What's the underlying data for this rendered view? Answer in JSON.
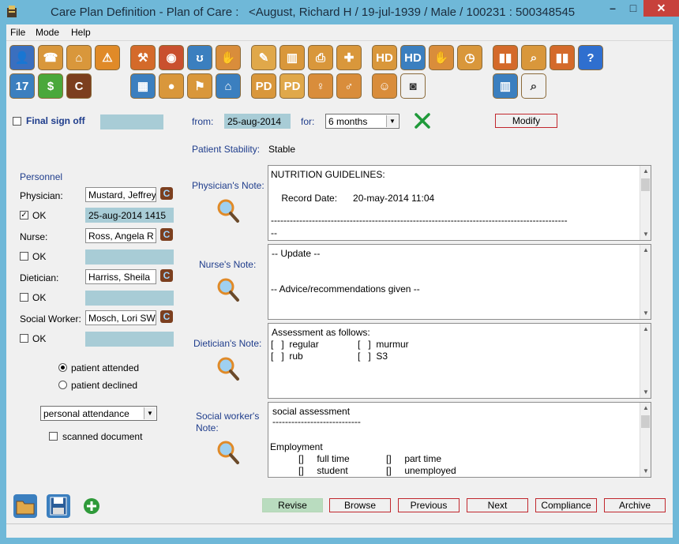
{
  "window": {
    "title": "Care Plan Definition - Plan of Care :   <August, Richard H / 19-jul-1939 / Male / 100231 : 500348545",
    "minimize": "–",
    "maximize": "□",
    "close": "✕"
  },
  "menu": [
    "File",
    "Mode",
    "Help"
  ],
  "toolbar": {
    "row1": [
      {
        "name": "patient-icon",
        "glyph": "👤",
        "color": "#3a6fbf"
      },
      {
        "name": "phone-icon",
        "glyph": "☎",
        "color": "#d9973b"
      },
      {
        "name": "home-icon",
        "glyph": "⌂",
        "color": "#d9973b"
      },
      {
        "name": "warning-icon",
        "glyph": "⚠",
        "color": "#e08a28"
      },
      {
        "name": "gavel-icon",
        "glyph": "⚒",
        "color": "#d46a2a"
      },
      {
        "name": "pills-icon",
        "glyph": "◉",
        "color": "#c9502f"
      },
      {
        "name": "stethoscope-icon",
        "glyph": "ʊ",
        "color": "#3b7fbf"
      },
      {
        "name": "handshake-icon",
        "glyph": "✋",
        "color": "#d98d3b"
      },
      {
        "name": "notepad-icon",
        "glyph": "✎",
        "color": "#e0a84a"
      },
      {
        "name": "bar-chart-icon",
        "glyph": "▥",
        "color": "#d9973b"
      },
      {
        "name": "printer-icon",
        "glyph": "⎙",
        "color": "#d9973b"
      },
      {
        "name": "first-aid-icon",
        "glyph": "✚",
        "color": "#d9973b"
      },
      {
        "name": "hd-icon",
        "glyph": "HD",
        "color": "#d9973b"
      },
      {
        "name": "hd-blue-icon",
        "glyph": "HD",
        "color": "#3b7fbf"
      },
      {
        "name": "hand-icon",
        "glyph": "✋",
        "color": "#d98d3b"
      },
      {
        "name": "clock-icon",
        "glyph": "◷",
        "color": "#d9973b"
      },
      {
        "name": "test-tubes-icon",
        "glyph": "▮▮",
        "color": "#d46a2a"
      },
      {
        "name": "report-search-icon",
        "glyph": "⌕",
        "color": "#d9973b"
      },
      {
        "name": "test-tubes-chart-icon",
        "glyph": "▮▮",
        "color": "#d46a2a"
      },
      {
        "name": "help-icon",
        "glyph": "?",
        "color": "#2f6fcf"
      }
    ],
    "row2": [
      {
        "name": "calendar-icon",
        "glyph": "17",
        "color": "#3b7fbf"
      },
      {
        "name": "dollar-icon",
        "glyph": "$",
        "color": "#4aa83b"
      },
      {
        "name": "c-logo-icon",
        "glyph": "C",
        "color": "#7c3f1f"
      },
      {
        "name": "grid-icon",
        "glyph": "▦",
        "color": "#3b7fbf"
      },
      {
        "name": "apple-icon",
        "glyph": "●",
        "color": "#d9973b"
      },
      {
        "name": "flag-icon",
        "glyph": "⚑",
        "color": "#d9973b"
      },
      {
        "name": "house-blue-icon",
        "glyph": "⌂",
        "color": "#3b7fbf"
      },
      {
        "name": "pd-icon",
        "glyph": "PD",
        "color": "#d9973b"
      },
      {
        "name": "pd-red-icon",
        "glyph": "PD",
        "color": "#e0a84a"
      },
      {
        "name": "body-front-icon",
        "glyph": "♀",
        "color": "#d98d3b"
      },
      {
        "name": "body-back-icon",
        "glyph": "♂",
        "color": "#d98d3b"
      },
      {
        "name": "group-icon",
        "glyph": "☺",
        "color": "#d98d3b"
      },
      {
        "name": "camera-icon",
        "glyph": "◙",
        "color": "#f0f0f0"
      },
      {
        "name": "chart-blue-icon",
        "glyph": "▥",
        "color": "#3b7fbf"
      },
      {
        "name": "magnifier-icon",
        "glyph": "⌕",
        "color": "#f0f0f0"
      }
    ]
  },
  "header": {
    "final_sign_off": "Final sign off",
    "from_label": "from:",
    "from_value": "25-aug-2014",
    "for_label": "for:",
    "for_value": "6 months",
    "modify": "Modify",
    "stability_label": "Patient Stability:",
    "stability_value": "Stable"
  },
  "personnel": {
    "heading": "Personnel",
    "physician_label": "Physician:",
    "physician_value": "Mustard, Jeffrey",
    "physician_ok": "OK",
    "physician_ok_date": "25-aug-2014 1415",
    "nurse_label": "Nurse:",
    "nurse_value": "Ross, Angela R",
    "nurse_ok": "OK",
    "dietician_label": "Dietician:",
    "dietician_value": "Harriss, Sheila",
    "dietician_ok": "OK",
    "social_label": "Social Worker:",
    "social_value": "Mosch, Lori  SW",
    "social_ok": "OK",
    "attended": "patient attended",
    "declined": "patient declined",
    "attendance_select": "personal attendance",
    "scanned": "scanned document"
  },
  "notes": {
    "physician_label": "Physician's Note:",
    "physician_lines": [
      "NUTRITION GUIDELINES:",
      "    Record Date:      20-may-2014 11:04",
      "----------------------------------------------------------------------------------------------",
      "--"
    ],
    "nurse_label": "Nurse's Note:",
    "nurse_lines": [
      "-- Update --",
      "-- Advice/recommendations given --"
    ],
    "dietician_label": "Dietician's Note:",
    "dietician_lines": [
      "Assessment as follows:",
      "[   ]  regular",
      "[   ]  murmur",
      "[   ]  rub",
      "[   ]  S3"
    ],
    "social_label_1": "Social worker's",
    "social_label_2": "Note:",
    "social_lines": [
      "social assessment",
      "----------------------------",
      "Employment",
      "[]     full time",
      "[]     part time",
      "[]     student",
      "[]     unemployed"
    ]
  },
  "buttons": {
    "revise": "Revise",
    "browse": "Browse",
    "previous": "Previous",
    "next": "Next",
    "compliance": "Compliance",
    "archive": "Archive"
  }
}
